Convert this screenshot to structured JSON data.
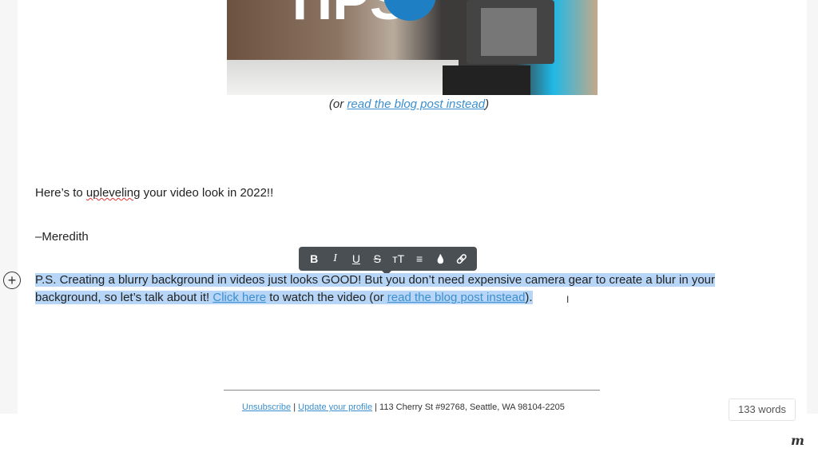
{
  "email": {
    "caption": {
      "open": "(",
      "or": "or ",
      "link": "read the blog post instead",
      "close": ")"
    },
    "line1": {
      "pre": "Here’s to ",
      "misspelled": "upleveling",
      "post": " your video look in 2022!!"
    },
    "signature": "–Meredith",
    "ps": {
      "text1": "P.S. Creating a blurry background in videos just looks GOOD! But you don’t need expensive camera gear to create a blur in your background, so let’s talk about it! ",
      "link1": "Click here",
      "text2": " to watch the video (or ",
      "link2": "read the blog post instead",
      "text3": ")."
    },
    "footer": {
      "unsubscribe": "Unsubscribe",
      "sep": " | ",
      "update": "Update your profile",
      "address": " | 113 Cherry St #92768, Seattle, WA 98104-2205"
    }
  },
  "toolbar": {
    "bold": "B",
    "italic": "I",
    "underline": "U",
    "strike": "S",
    "size": "тT",
    "align": "≡",
    "color": "💧",
    "link": "🔗"
  },
  "add_block": "+",
  "word_count": "133 words",
  "logo": "m",
  "colors": {
    "selection": "#b7d6f7",
    "link": "#3b8fce",
    "toolbar": "#4a4f54"
  }
}
